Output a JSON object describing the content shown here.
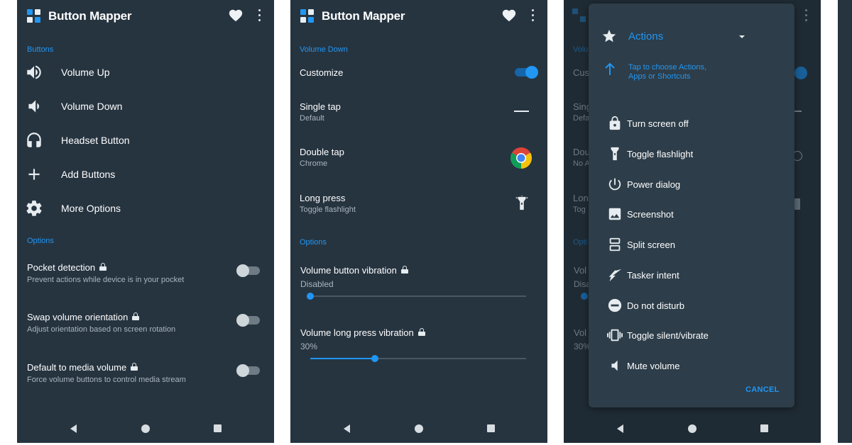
{
  "screen1": {
    "app_title": "Button Mapper",
    "section_buttons": "Buttons",
    "items": [
      {
        "label": "Volume Up",
        "icon": "volume-up-icon"
      },
      {
        "label": "Volume Down",
        "icon": "volume-down-icon"
      },
      {
        "label": "Headset Button",
        "icon": "headset-icon"
      },
      {
        "label": "Add Buttons",
        "icon": "plus-icon"
      },
      {
        "label": "More Options",
        "icon": "gear-icon"
      }
    ],
    "section_options": "Options",
    "options": [
      {
        "title": "Pocket detection",
        "subtitle": "Prevent actions while device is in your pocket",
        "enabled": false
      },
      {
        "title": "Swap volume orientation",
        "subtitle": "Adjust orientation based on screen rotation",
        "enabled": false
      },
      {
        "title": "Default to media volume",
        "subtitle": "Force volume buttons to control media stream",
        "enabled": false
      }
    ]
  },
  "screen2": {
    "app_title": "Button Mapper",
    "section_title": "Volume Down",
    "customize_label": "Customize",
    "customize_enabled": true,
    "actions": [
      {
        "title": "Single tap",
        "value": "Default",
        "icon": "dash-icon"
      },
      {
        "title": "Double tap",
        "value": "Chrome",
        "icon": "chrome-icon"
      },
      {
        "title": "Long press",
        "value": "Toggle flashlight",
        "icon": "flashlight-icon"
      }
    ],
    "section_options": "Options",
    "vibration": {
      "title": "Volume button vibration",
      "value": "Disabled",
      "level": 0
    },
    "long_press_vibration": {
      "title": "Volume long press vibration",
      "value": "30%",
      "level": 0.3
    }
  },
  "screen3": {
    "background": {
      "app_partial": "Volu",
      "cus": "Cus",
      "sing": "Sing",
      "def": "Defa",
      "dou": "Dou",
      "noa": "No A",
      "lon": "Lon",
      "tog": "Tog",
      "opt": "Opti",
      "vol1": "Vol",
      "dis": "Disa",
      "vol2": "Vol",
      "pct": "30%"
    },
    "dialog": {
      "title": "Actions",
      "hint": "Tap to choose Actions, Apps or Shortcuts",
      "items": [
        {
          "label": "Turn screen off",
          "icon": "lock-icon"
        },
        {
          "label": "Toggle flashlight",
          "icon": "flashlight-icon"
        },
        {
          "label": "Power dialog",
          "icon": "power-icon"
        },
        {
          "label": "Screenshot",
          "icon": "screenshot-icon"
        },
        {
          "label": "Split screen",
          "icon": "split-screen-icon"
        },
        {
          "label": "Tasker intent",
          "icon": "tasker-icon"
        },
        {
          "label": "Do not disturb",
          "icon": "do-not-disturb-icon"
        },
        {
          "label": "Toggle silent/vibrate",
          "icon": "vibrate-icon"
        },
        {
          "label": "Mute volume",
          "icon": "mute-icon"
        }
      ],
      "cancel_label": "CANCEL"
    }
  },
  "colors": {
    "background": "#263440",
    "accent": "#2196f3",
    "dialog": "#2d3d49",
    "text": "#ffffff",
    "secondary_text": "#a9b6bf"
  }
}
